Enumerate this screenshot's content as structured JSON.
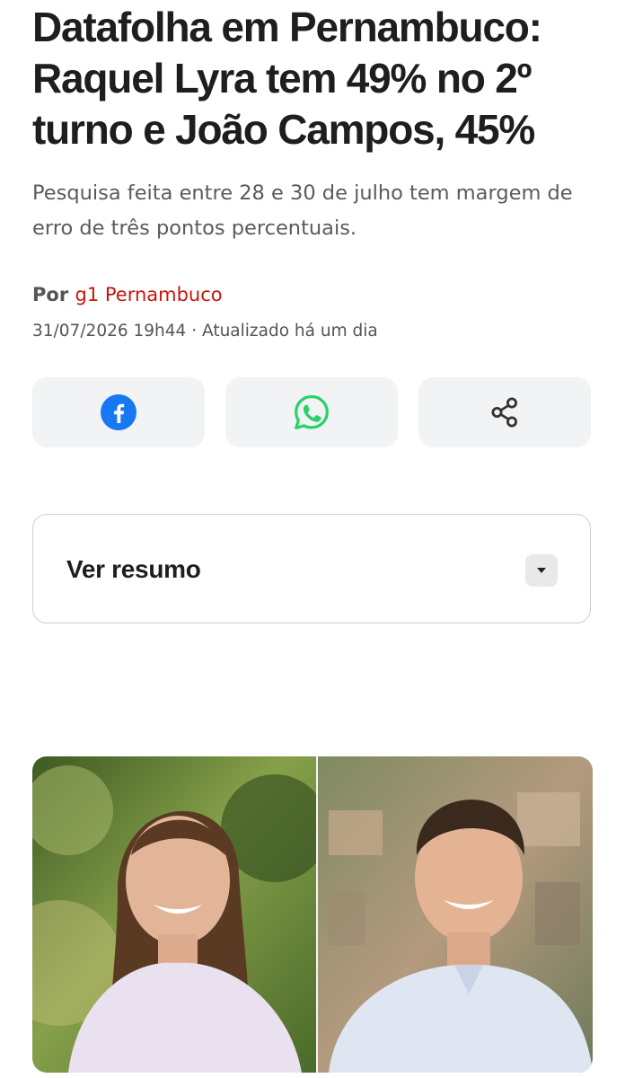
{
  "article": {
    "headline": "Datafolha em Pernambuco: Raquel Lyra tem 49% no 2º turno e João Campos, 45%",
    "subtitle": "Pesquisa feita entre 28 e 30 de julho tem margem de erro de três pontos percentuais.",
    "byline_prefix": "Por",
    "author": "g1 Pernambuco",
    "date": "31/07/2026 19h44",
    "separator": "·",
    "updated": "Atualizado há um dia"
  },
  "share": [
    {
      "icon": "facebook-icon",
      "color": "#1877f2"
    },
    {
      "icon": "whatsapp-icon",
      "color": "#25d366"
    },
    {
      "icon": "share-icon",
      "color": "#333333"
    }
  ],
  "summary": {
    "label": "Ver resumo",
    "icon": "caret-down-icon"
  },
  "colors": {
    "accent": "#c4170c",
    "button_bg": "#f2f3f5",
    "headline": "#1e1e1e"
  }
}
